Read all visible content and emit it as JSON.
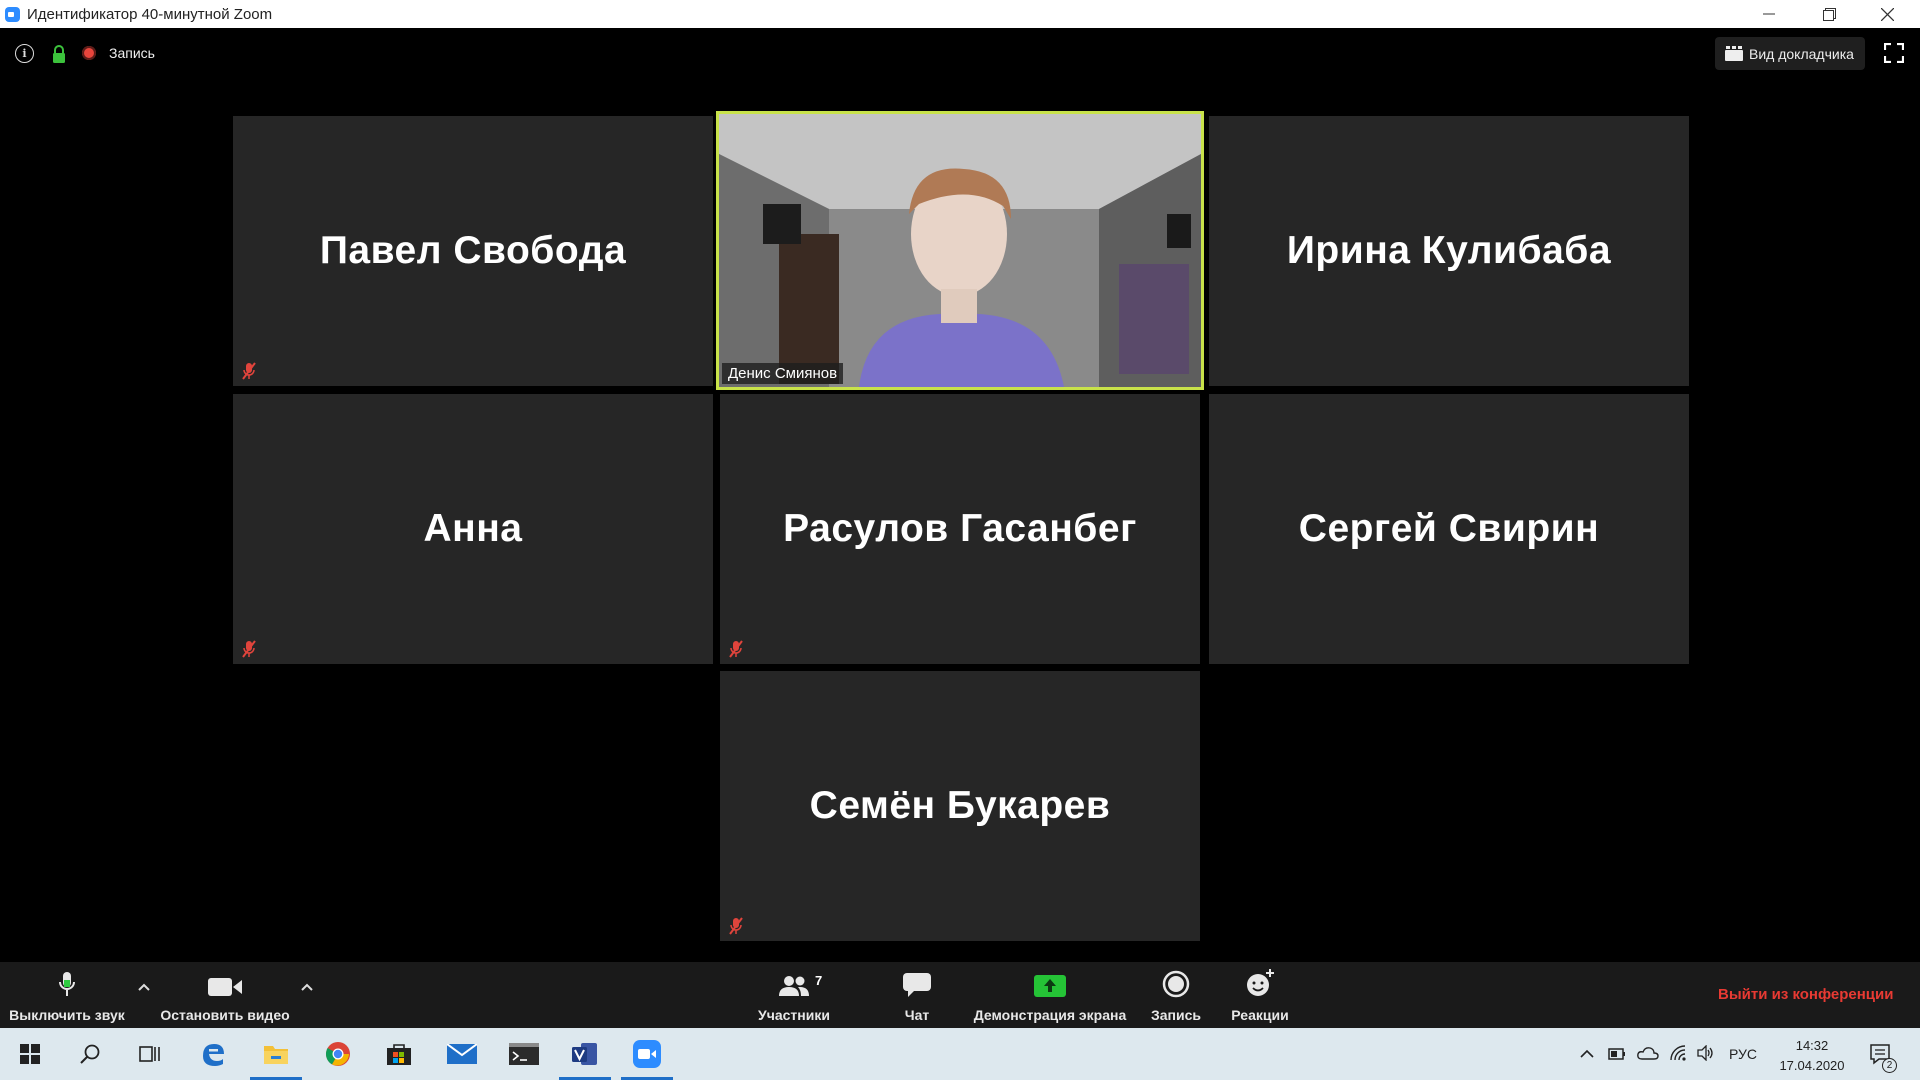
{
  "window": {
    "title": "Идентификатор 40-минутной Zoom",
    "minimize_icon": "minimize-icon",
    "restore_icon": "restore-icon",
    "close_icon": "close-icon"
  },
  "meeting_bar": {
    "recording_label": "Запись",
    "speaker_view_label": "Вид докладчика"
  },
  "participants_tiles": [
    {
      "name": "Павел Свобода",
      "muted": true
    },
    {
      "name": "Ирина Кулибаба",
      "muted": false
    },
    {
      "name": "Анна",
      "muted": true
    },
    {
      "name": "Расулов Гасанбег",
      "muted": true
    },
    {
      "name": "Сергей Свирин",
      "muted": false
    },
    {
      "name": "Семён Букарев",
      "muted": true
    }
  ],
  "active_speaker": {
    "name": "Денис Смиянов"
  },
  "toolbar": {
    "mute_label": "Выключить звук",
    "video_label": "Остановить видео",
    "participants_label": "Участники",
    "participants_count": "7",
    "chat_label": "Чат",
    "share_label": "Демонстрация экрана",
    "record_label": "Запись",
    "reactions_label": "Реакции",
    "leave_label": "Выйти из конференции"
  },
  "colors": {
    "share_green": "#25c336",
    "leave_red": "#e83a33",
    "active_border": "#c8e24a",
    "mute_red": "#e0443c",
    "taskbar_bg": "#dde8ee"
  },
  "taskbar": {
    "apps": [
      "windows-start-icon",
      "search-icon",
      "task-view-icon",
      "edge-icon",
      "file-explorer-icon",
      "chrome-icon",
      "store-icon",
      "mail-icon",
      "terminal-icon",
      "visio-icon",
      "zoom-icon"
    ],
    "language": "РУС",
    "time": "14:32",
    "date": "17.04.2020",
    "notifications_count": "2"
  }
}
